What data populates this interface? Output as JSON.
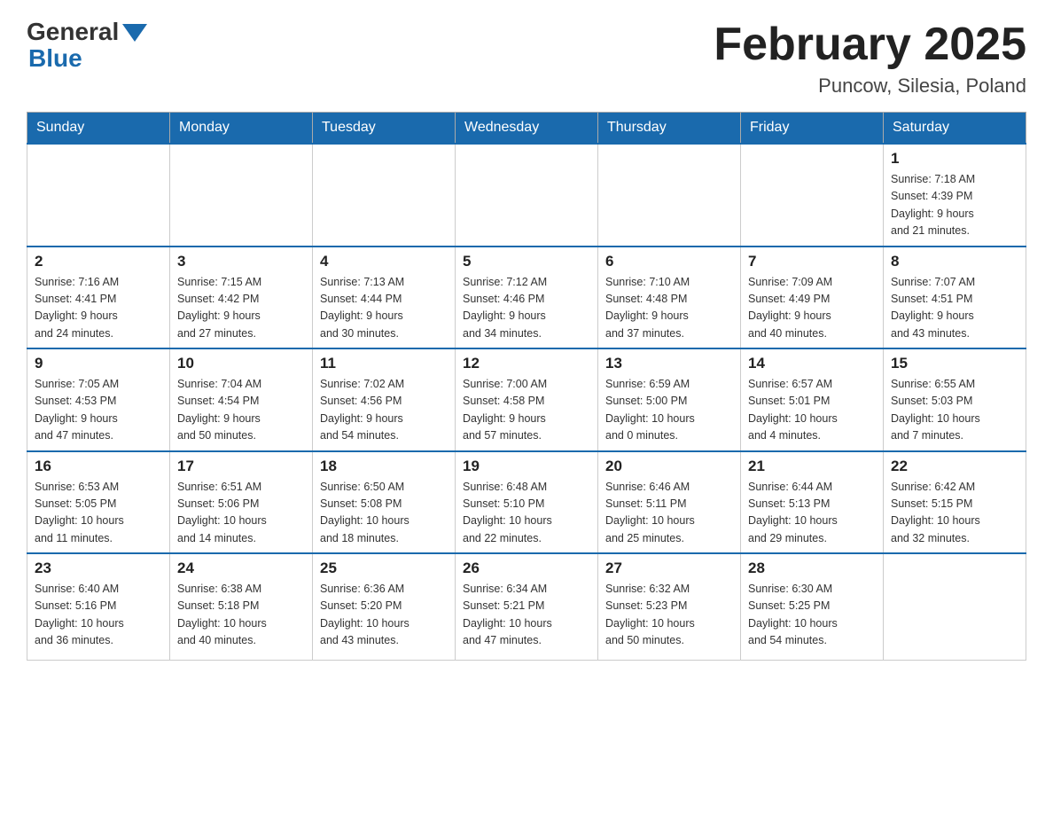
{
  "header": {
    "logo_general": "General",
    "logo_blue": "Blue",
    "title": "February 2025",
    "location": "Puncow, Silesia, Poland"
  },
  "weekdays": [
    "Sunday",
    "Monday",
    "Tuesday",
    "Wednesday",
    "Thursday",
    "Friday",
    "Saturday"
  ],
  "weeks": [
    [
      {
        "day": "",
        "info": ""
      },
      {
        "day": "",
        "info": ""
      },
      {
        "day": "",
        "info": ""
      },
      {
        "day": "",
        "info": ""
      },
      {
        "day": "",
        "info": ""
      },
      {
        "day": "",
        "info": ""
      },
      {
        "day": "1",
        "info": "Sunrise: 7:18 AM\nSunset: 4:39 PM\nDaylight: 9 hours\nand 21 minutes."
      }
    ],
    [
      {
        "day": "2",
        "info": "Sunrise: 7:16 AM\nSunset: 4:41 PM\nDaylight: 9 hours\nand 24 minutes."
      },
      {
        "day": "3",
        "info": "Sunrise: 7:15 AM\nSunset: 4:42 PM\nDaylight: 9 hours\nand 27 minutes."
      },
      {
        "day": "4",
        "info": "Sunrise: 7:13 AM\nSunset: 4:44 PM\nDaylight: 9 hours\nand 30 minutes."
      },
      {
        "day": "5",
        "info": "Sunrise: 7:12 AM\nSunset: 4:46 PM\nDaylight: 9 hours\nand 34 minutes."
      },
      {
        "day": "6",
        "info": "Sunrise: 7:10 AM\nSunset: 4:48 PM\nDaylight: 9 hours\nand 37 minutes."
      },
      {
        "day": "7",
        "info": "Sunrise: 7:09 AM\nSunset: 4:49 PM\nDaylight: 9 hours\nand 40 minutes."
      },
      {
        "day": "8",
        "info": "Sunrise: 7:07 AM\nSunset: 4:51 PM\nDaylight: 9 hours\nand 43 minutes."
      }
    ],
    [
      {
        "day": "9",
        "info": "Sunrise: 7:05 AM\nSunset: 4:53 PM\nDaylight: 9 hours\nand 47 minutes."
      },
      {
        "day": "10",
        "info": "Sunrise: 7:04 AM\nSunset: 4:54 PM\nDaylight: 9 hours\nand 50 minutes."
      },
      {
        "day": "11",
        "info": "Sunrise: 7:02 AM\nSunset: 4:56 PM\nDaylight: 9 hours\nand 54 minutes."
      },
      {
        "day": "12",
        "info": "Sunrise: 7:00 AM\nSunset: 4:58 PM\nDaylight: 9 hours\nand 57 minutes."
      },
      {
        "day": "13",
        "info": "Sunrise: 6:59 AM\nSunset: 5:00 PM\nDaylight: 10 hours\nand 0 minutes."
      },
      {
        "day": "14",
        "info": "Sunrise: 6:57 AM\nSunset: 5:01 PM\nDaylight: 10 hours\nand 4 minutes."
      },
      {
        "day": "15",
        "info": "Sunrise: 6:55 AM\nSunset: 5:03 PM\nDaylight: 10 hours\nand 7 minutes."
      }
    ],
    [
      {
        "day": "16",
        "info": "Sunrise: 6:53 AM\nSunset: 5:05 PM\nDaylight: 10 hours\nand 11 minutes."
      },
      {
        "day": "17",
        "info": "Sunrise: 6:51 AM\nSunset: 5:06 PM\nDaylight: 10 hours\nand 14 minutes."
      },
      {
        "day": "18",
        "info": "Sunrise: 6:50 AM\nSunset: 5:08 PM\nDaylight: 10 hours\nand 18 minutes."
      },
      {
        "day": "19",
        "info": "Sunrise: 6:48 AM\nSunset: 5:10 PM\nDaylight: 10 hours\nand 22 minutes."
      },
      {
        "day": "20",
        "info": "Sunrise: 6:46 AM\nSunset: 5:11 PM\nDaylight: 10 hours\nand 25 minutes."
      },
      {
        "day": "21",
        "info": "Sunrise: 6:44 AM\nSunset: 5:13 PM\nDaylight: 10 hours\nand 29 minutes."
      },
      {
        "day": "22",
        "info": "Sunrise: 6:42 AM\nSunset: 5:15 PM\nDaylight: 10 hours\nand 32 minutes."
      }
    ],
    [
      {
        "day": "23",
        "info": "Sunrise: 6:40 AM\nSunset: 5:16 PM\nDaylight: 10 hours\nand 36 minutes."
      },
      {
        "day": "24",
        "info": "Sunrise: 6:38 AM\nSunset: 5:18 PM\nDaylight: 10 hours\nand 40 minutes."
      },
      {
        "day": "25",
        "info": "Sunrise: 6:36 AM\nSunset: 5:20 PM\nDaylight: 10 hours\nand 43 minutes."
      },
      {
        "day": "26",
        "info": "Sunrise: 6:34 AM\nSunset: 5:21 PM\nDaylight: 10 hours\nand 47 minutes."
      },
      {
        "day": "27",
        "info": "Sunrise: 6:32 AM\nSunset: 5:23 PM\nDaylight: 10 hours\nand 50 minutes."
      },
      {
        "day": "28",
        "info": "Sunrise: 6:30 AM\nSunset: 5:25 PM\nDaylight: 10 hours\nand 54 minutes."
      },
      {
        "day": "",
        "info": ""
      }
    ]
  ]
}
